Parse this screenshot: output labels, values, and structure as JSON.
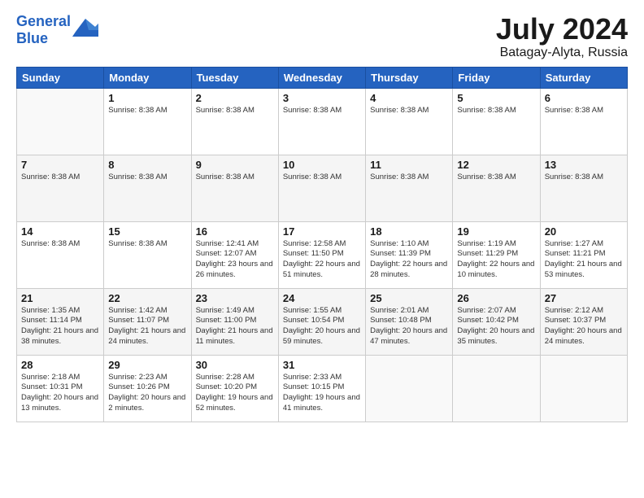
{
  "header": {
    "logo_line1": "General",
    "logo_line2": "Blue",
    "month": "July 2024",
    "location": "Batagay-Alyta, Russia"
  },
  "weekdays": [
    "Sunday",
    "Monday",
    "Tuesday",
    "Wednesday",
    "Thursday",
    "Friday",
    "Saturday"
  ],
  "weeks": [
    [
      {
        "day": "",
        "info": ""
      },
      {
        "day": "1",
        "info": "Sunrise: 8:38 AM"
      },
      {
        "day": "2",
        "info": "Sunrise: 8:38 AM"
      },
      {
        "day": "3",
        "info": "Sunrise: 8:38 AM"
      },
      {
        "day": "4",
        "info": "Sunrise: 8:38 AM"
      },
      {
        "day": "5",
        "info": "Sunrise: 8:38 AM"
      },
      {
        "day": "6",
        "info": "Sunrise: 8:38 AM"
      }
    ],
    [
      {
        "day": "7",
        "info": "Sunrise: 8:38 AM"
      },
      {
        "day": "8",
        "info": "Sunrise: 8:38 AM"
      },
      {
        "day": "9",
        "info": "Sunrise: 8:38 AM"
      },
      {
        "day": "10",
        "info": "Sunrise: 8:38 AM"
      },
      {
        "day": "11",
        "info": "Sunrise: 8:38 AM"
      },
      {
        "day": "12",
        "info": "Sunrise: 8:38 AM"
      },
      {
        "day": "13",
        "info": "Sunrise: 8:38 AM"
      }
    ],
    [
      {
        "day": "14",
        "info": "Sunrise: 8:38 AM"
      },
      {
        "day": "15",
        "info": "Sunrise: 8:38 AM"
      },
      {
        "day": "16",
        "info": "Sunrise: 12:41 AM\nSunset: 12:07 AM\nDaylight: 23 hours and 26 minutes."
      },
      {
        "day": "17",
        "info": "Sunrise: 12:58 AM\nSunset: 11:50 PM\nDaylight: 22 hours and 51 minutes."
      },
      {
        "day": "18",
        "info": "Sunrise: 1:10 AM\nSunset: 11:39 PM\nDaylight: 22 hours and 28 minutes."
      },
      {
        "day": "19",
        "info": "Sunrise: 1:19 AM\nSunset: 11:29 PM\nDaylight: 22 hours and 10 minutes."
      },
      {
        "day": "20",
        "info": "Sunrise: 1:27 AM\nSunset: 11:21 PM\nDaylight: 21 hours and 53 minutes."
      }
    ],
    [
      {
        "day": "21",
        "info": "Sunrise: 1:35 AM\nSunset: 11:14 PM\nDaylight: 21 hours and 38 minutes."
      },
      {
        "day": "22",
        "info": "Sunrise: 1:42 AM\nSunset: 11:07 PM\nDaylight: 21 hours and 24 minutes."
      },
      {
        "day": "23",
        "info": "Sunrise: 1:49 AM\nSunset: 11:00 PM\nDaylight: 21 hours and 11 minutes."
      },
      {
        "day": "24",
        "info": "Sunrise: 1:55 AM\nSunset: 10:54 PM\nDaylight: 20 hours and 59 minutes."
      },
      {
        "day": "25",
        "info": "Sunrise: 2:01 AM\nSunset: 10:48 PM\nDaylight: 20 hours and 47 minutes."
      },
      {
        "day": "26",
        "info": "Sunrise: 2:07 AM\nSunset: 10:42 PM\nDaylight: 20 hours and 35 minutes."
      },
      {
        "day": "27",
        "info": "Sunrise: 2:12 AM\nSunset: 10:37 PM\nDaylight: 20 hours and 24 minutes."
      }
    ],
    [
      {
        "day": "28",
        "info": "Sunrise: 2:18 AM\nSunset: 10:31 PM\nDaylight: 20 hours and 13 minutes."
      },
      {
        "day": "29",
        "info": "Sunrise: 2:23 AM\nSunset: 10:26 PM\nDaylight: 20 hours and 2 minutes."
      },
      {
        "day": "30",
        "info": "Sunrise: 2:28 AM\nSunset: 10:20 PM\nDaylight: 19 hours and 52 minutes."
      },
      {
        "day": "31",
        "info": "Sunrise: 2:33 AM\nSunset: 10:15 PM\nDaylight: 19 hours and 41 minutes."
      },
      {
        "day": "",
        "info": ""
      },
      {
        "day": "",
        "info": ""
      },
      {
        "day": "",
        "info": ""
      }
    ]
  ]
}
